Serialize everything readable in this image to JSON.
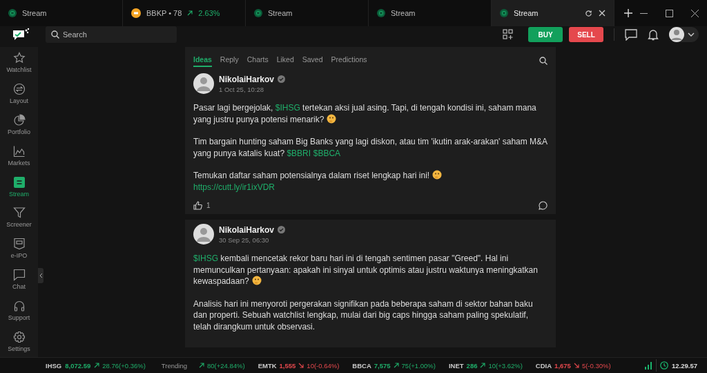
{
  "tabs": [
    {
      "kind": "stream",
      "label": "Stream",
      "selected": false
    },
    {
      "kind": "stock",
      "label": "BBKP • 78",
      "change": "2.63%",
      "selected": false
    },
    {
      "kind": "stream",
      "label": "Stream",
      "selected": false
    },
    {
      "kind": "stream",
      "label": "Stream",
      "selected": false
    },
    {
      "kind": "stream",
      "label": "Stream",
      "selected": true
    }
  ],
  "search": {
    "placeholder": "Search"
  },
  "actions": {
    "buy": "BUY",
    "sell": "SELL"
  },
  "sidebar": [
    {
      "label": "Watchlist",
      "selected": false
    },
    {
      "label": "Layout",
      "selected": false
    },
    {
      "label": "Portfolio",
      "selected": false
    },
    {
      "label": "Markets",
      "selected": false
    },
    {
      "label": "Stream",
      "selected": true
    },
    {
      "label": "Screener",
      "selected": false
    },
    {
      "label": "e-IPO",
      "selected": false
    },
    {
      "label": "Chat",
      "selected": false
    },
    {
      "label": "Support",
      "selected": false
    },
    {
      "label": "Settings",
      "selected": false
    }
  ],
  "feed_tabs": [
    {
      "label": "Ideas",
      "selected": true
    },
    {
      "label": "Reply",
      "selected": false
    },
    {
      "label": "Charts",
      "selected": false
    },
    {
      "label": "Liked",
      "selected": false
    },
    {
      "label": "Saved",
      "selected": false
    },
    {
      "label": "Predictions",
      "selected": false
    }
  ],
  "posts": [
    {
      "author": "NikolaiHarkov",
      "verified": true,
      "time": "1 Oct 25, 10:28",
      "likes": "1",
      "paragraphs": [
        [
          {
            "kind": "text",
            "text": "Pasar lagi bergejolak, "
          },
          {
            "kind": "ticker",
            "text": "$IHSG"
          },
          {
            "kind": "text",
            "text": " tertekan aksi jual asing. Tapi, di tengah kondisi ini, saham mana yang justru punya potensi menarik?"
          },
          {
            "kind": "emoji"
          }
        ],
        [
          {
            "kind": "text",
            "text": "Tim bargain hunting saham Big Banks yang lagi diskon, atau tim 'ikutin arak-arakan' saham M&A yang punya katalis kuat? "
          },
          {
            "kind": "ticker",
            "text": "$BBRI"
          },
          {
            "kind": "ticker",
            "text": "$BBCA"
          }
        ],
        [
          {
            "kind": "text",
            "text": "Temukan daftar saham potensialnya dalam riset lengkap hari ini!"
          },
          {
            "kind": "emoji"
          },
          {
            "kind": "break"
          },
          {
            "kind": "link",
            "text": "https://cutt.ly/ir1ixVDR"
          }
        ]
      ]
    },
    {
      "author": "NikolaiHarkov",
      "verified": true,
      "time": "30 Sep 25, 06:30",
      "paragraphs": [
        [
          {
            "kind": "ticker",
            "text": "$IHSG"
          },
          {
            "kind": "text",
            "text": " kembali mencetak rekor baru hari ini di tengah sentimen pasar \"Greed\". Hal ini memunculkan pertanyaan: apakah ini sinyal untuk optimis atau justru waktunya meningkatkan kewaspadaan?"
          },
          {
            "kind": "emoji"
          }
        ],
        [
          {
            "kind": "text",
            "text": "Analisis hari ini menyoroti pergerakan signifikan pada beberapa saham di sektor bahan baku dan properti. Sebuah watchlist lengkap, mulai dari big caps hingga saham paling spekulatif, telah dirangkum untuk observasi."
          }
        ]
      ]
    }
  ],
  "ticker_bar": {
    "index": {
      "symbol": "IHSG",
      "price": "8,072.59",
      "change": "28.76(+0.36%)",
      "rising": true
    },
    "trending_label": "Trending",
    "items": [
      {
        "change": "80(+24.84%)",
        "rising": true
      },
      {
        "symbol": "EMTK",
        "price": "1,555",
        "change": "10(-0.64%)",
        "rising": false
      },
      {
        "symbol": "BBCA",
        "price": "7,575",
        "change": "75(+1.00%)",
        "rising": true
      },
      {
        "symbol": "INET",
        "price": "286",
        "change": "10(+3.62%)",
        "rising": true
      },
      {
        "symbol": "CDIA",
        "price": "1,675",
        "change": "5(-0.30%)",
        "rising": false
      }
    ],
    "clock": "12.29.57"
  }
}
